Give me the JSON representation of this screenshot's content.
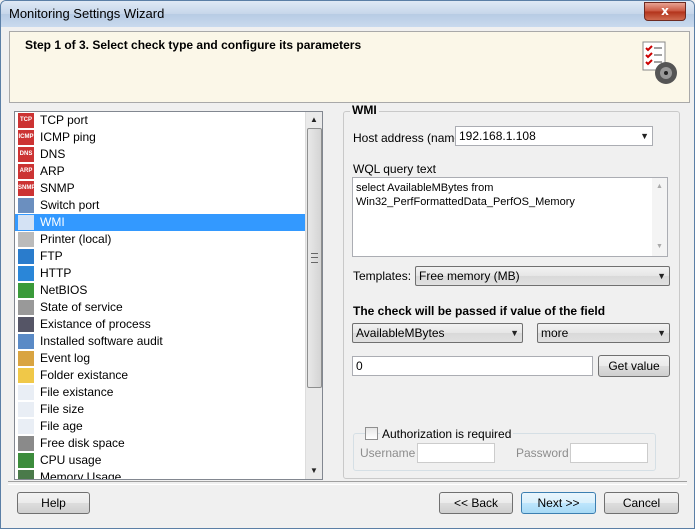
{
  "window": {
    "title": "Monitoring Settings Wizard",
    "close_glyph": "x"
  },
  "header": {
    "step_text": "Step 1 of 3. Select check type and configure its parameters"
  },
  "check_types": [
    {
      "label": "TCP port",
      "icon": "tcp-icon",
      "icon_text": "TCP"
    },
    {
      "label": "ICMP ping",
      "icon": "icmp-icon",
      "icon_text": "ICMP"
    },
    {
      "label": "DNS",
      "icon": "dns-icon",
      "icon_text": "DNS"
    },
    {
      "label": "ARP",
      "icon": "arp-icon",
      "icon_text": "ARP"
    },
    {
      "label": "SNMP",
      "icon": "snmp-icon",
      "icon_text": "SNMP"
    },
    {
      "label": "Switch port",
      "icon": "switch-port-icon",
      "icon_text": ""
    },
    {
      "label": "WMI",
      "icon": "wmi-icon",
      "icon_text": "",
      "selected": true
    },
    {
      "label": "Printer (local)",
      "icon": "printer-icon",
      "icon_text": ""
    },
    {
      "label": "FTP",
      "icon": "ftp-icon",
      "icon_text": ""
    },
    {
      "label": "HTTP",
      "icon": "http-icon",
      "icon_text": ""
    },
    {
      "label": "NetBIOS",
      "icon": "netbios-icon",
      "icon_text": ""
    },
    {
      "label": "State of service",
      "icon": "service-icon",
      "icon_text": ""
    },
    {
      "label": "Existance of process",
      "icon": "process-icon",
      "icon_text": ""
    },
    {
      "label": "Installed software audit",
      "icon": "software-audit-icon",
      "icon_text": ""
    },
    {
      "label": "Event log",
      "icon": "event-log-icon",
      "icon_text": ""
    },
    {
      "label": "Folder existance",
      "icon": "folder-icon",
      "icon_text": ""
    },
    {
      "label": "File existance",
      "icon": "file-icon",
      "icon_text": ""
    },
    {
      "label": "File size",
      "icon": "file-size-icon",
      "icon_text": ""
    },
    {
      "label": "File age",
      "icon": "file-age-icon",
      "icon_text": ""
    },
    {
      "label": "Free disk space",
      "icon": "disk-space-icon",
      "icon_text": ""
    },
    {
      "label": "CPU usage",
      "icon": "cpu-icon",
      "icon_text": ""
    },
    {
      "label": "Memory Usage",
      "icon": "memory-icon",
      "icon_text": ""
    }
  ],
  "wmi": {
    "group_title": "WMI",
    "host_label": "Host address (name)",
    "host_value": "192.168.1.108",
    "query_label": "WQL query text",
    "query_line1": "select AvailableMBytes from",
    "query_line2": "Win32_PerfFormattedData_PerfOS_Memory",
    "templates_label": "Templates:",
    "templates_value": "Free memory (MB)",
    "condition_heading": "The check will be passed if value of the field",
    "field_value": "AvailableMBytes",
    "operator_value": "more",
    "threshold_value": "0",
    "get_value_button": "Get value",
    "auth_label": "Authorization is required",
    "username_label": "Username",
    "password_label": "Password"
  },
  "buttons": {
    "help": "Help",
    "back": "<< Back",
    "next": "Next >>",
    "cancel": "Cancel"
  },
  "colors": {
    "selection": "#3399ff",
    "header_bg": "#fbf7e8"
  }
}
